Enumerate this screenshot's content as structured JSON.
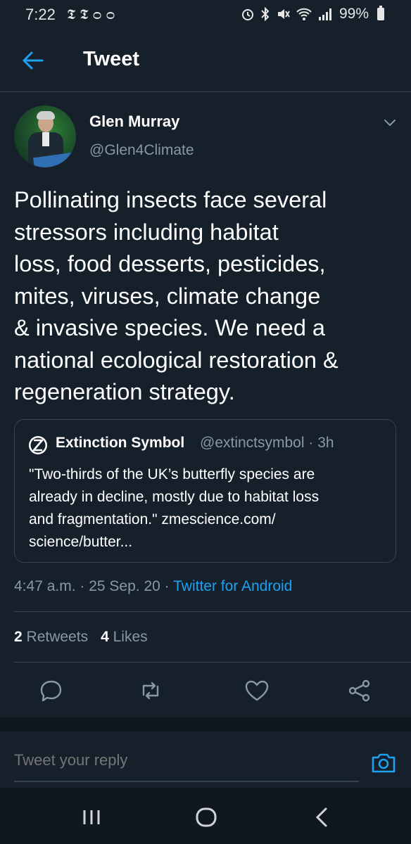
{
  "status_bar": {
    "time": "7:22",
    "left_icons": [
      "nyt-icon",
      "nyt-icon",
      "voicemail-icon"
    ],
    "right_icons": [
      "alarm-icon",
      "bluetooth-icon",
      "mute-icon",
      "wifi-icon",
      "signal-icon"
    ],
    "battery": "99%"
  },
  "header": {
    "title": "Tweet",
    "back_icon": "back-arrow-icon"
  },
  "author": {
    "name": "Glen Murray",
    "handle": "@Glen4Climate"
  },
  "tweet": {
    "text": "Pollinating insects face several\nstressors including habitat\nloss, food desserts, pesticides,\nmites, viruses, climate change\n& invasive species. We need a\nnational ecological restoration &\nregeneration strategy."
  },
  "quote": {
    "name": "Extinction Symbol",
    "handle": "@extinctsymbol",
    "time": "3h",
    "text": "\"Two-thirds of the UK’s butterfly species are\nalready in decline, mostly due to habitat loss\nand fragmentation.\" zmescience.com/\nscience/butter..."
  },
  "meta": {
    "time": "4:47 a.m.",
    "date": "25 Sep. 20",
    "source": "Twitter for Android"
  },
  "stats": {
    "retweets_count": "2",
    "retweets_label": "Retweets",
    "likes_count": "4",
    "likes_label": "Likes"
  },
  "actions": [
    "reply-icon",
    "retweet-icon",
    "like-icon",
    "share-icon"
  ],
  "reply": {
    "placeholder": "Tweet your reply"
  },
  "colors": {
    "background": "#15202b",
    "border": "#38444d",
    "secondary_text": "#8899a6",
    "accent": "#1da1f2"
  }
}
